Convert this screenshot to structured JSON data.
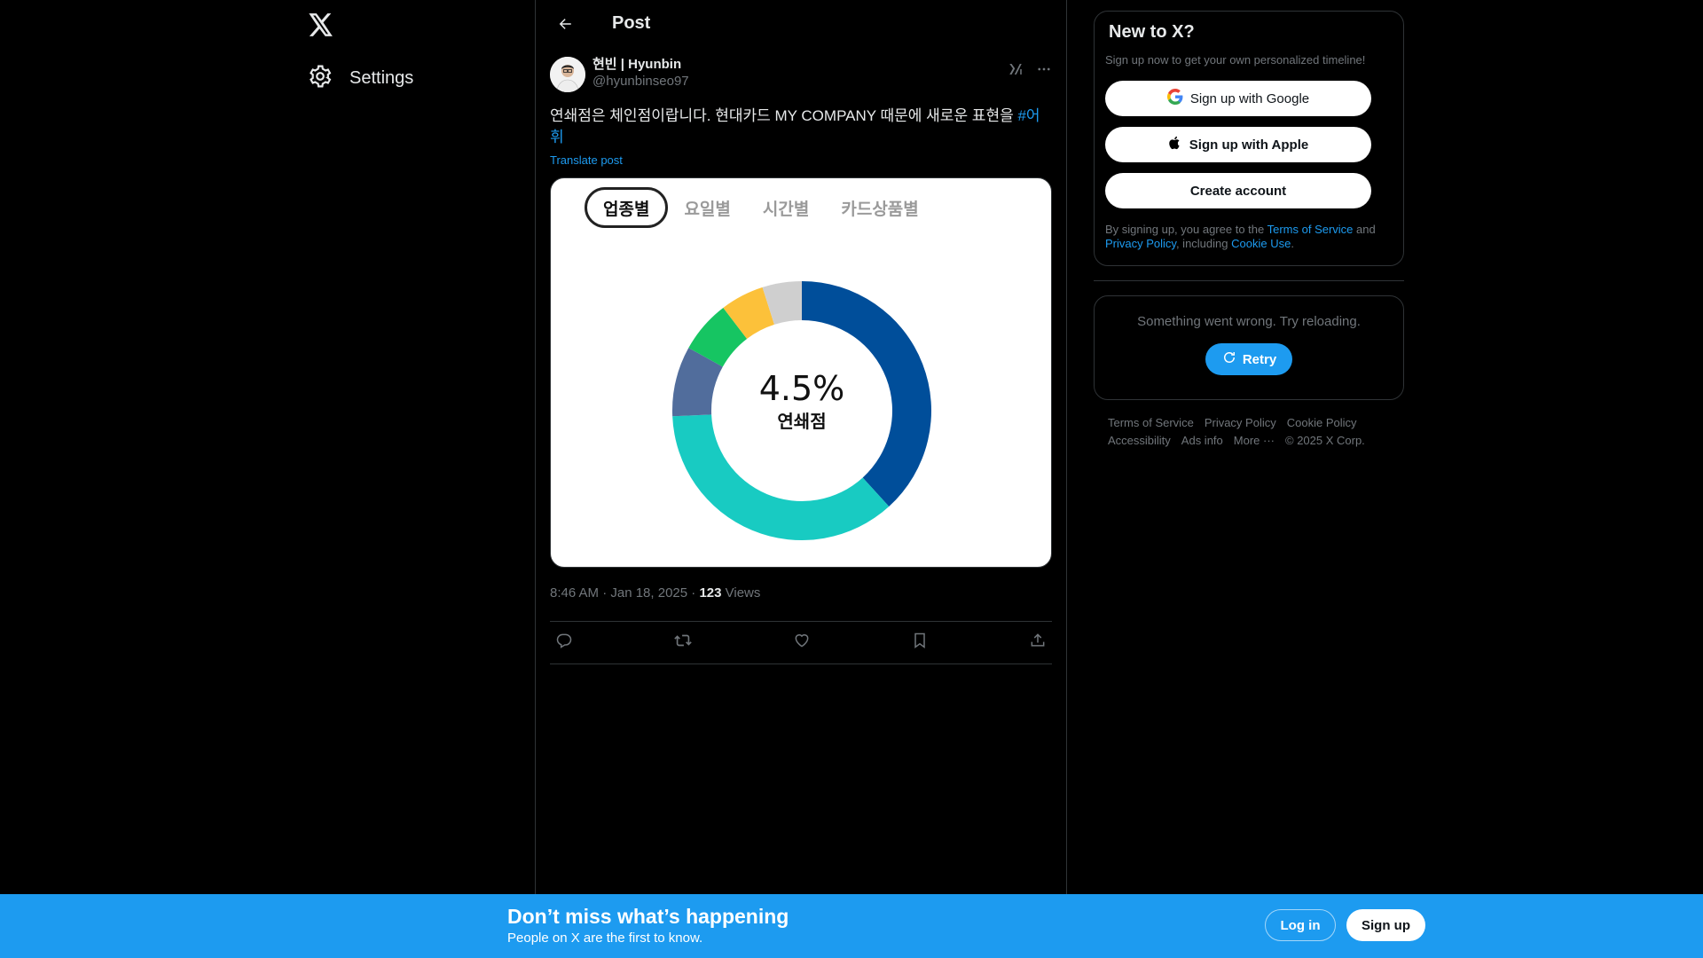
{
  "nav": {
    "logo_icon": "x-logo-icon",
    "settings_label": "Settings"
  },
  "header": {
    "title": "Post"
  },
  "post": {
    "display_name": "현빈 | Hyunbin",
    "handle": "@hyunbinseo97",
    "text": "연쇄점은 체인점이랍니다. 현대카드 MY COMPANY 때문에 새로운 표현을 ",
    "hashtag": "#어휘",
    "translate": "Translate post",
    "time": "8:46 AM · Jan 18, 2025 · ",
    "views_count": "123",
    "views_label": " Views"
  },
  "media": {
    "tabs": [
      "업종별",
      "요일별",
      "시간별",
      "카드상품별"
    ],
    "active_tab": 0,
    "center_value": "4.5%",
    "center_label": "연쇄점",
    "colors": {
      "navy": "#004e9a",
      "teal": "#18cbc2",
      "slate": "#516d9c",
      "green": "#16c562",
      "yellow": "#fcc13a",
      "gray": "#cfcfcf"
    }
  },
  "chart_data": {
    "type": "pie",
    "title": "",
    "center_text": "4.5%",
    "center_label": "연쇄점",
    "categories": [
      "",
      "",
      "",
      "",
      "",
      ""
    ],
    "values": [
      35,
      33,
      8,
      6,
      5,
      4.5
    ],
    "colors": [
      "#004e9a",
      "#18cbc2",
      "#516d9c",
      "#16c562",
      "#fcc13a",
      "#cfcfcf"
    ]
  },
  "signup": {
    "title": "New to X?",
    "subtitle": "Sign up now to get your own personalized timeline!",
    "google": "Sign up with Google",
    "apple": "Sign up with Apple",
    "create": "Create account",
    "terms_prefix": "By signing up, you agree to the ",
    "terms_link": "Terms of Service",
    "and": " and ",
    "privacy_link": "Privacy Policy",
    "including": ", including ",
    "cookie_link": "Cookie Use",
    "period": "."
  },
  "error": {
    "message": "Something went wrong. Try reloading.",
    "retry": "Retry"
  },
  "footer": {
    "links": [
      "Terms of Service",
      "Privacy Policy",
      "Cookie Policy",
      "Accessibility",
      "Ads info",
      "More ···",
      "© 2025 X Corp."
    ]
  },
  "bottom": {
    "title": "Don’t miss what’s happening",
    "subtitle": "People on X are the first to know.",
    "login": "Log in",
    "signup": "Sign up"
  }
}
